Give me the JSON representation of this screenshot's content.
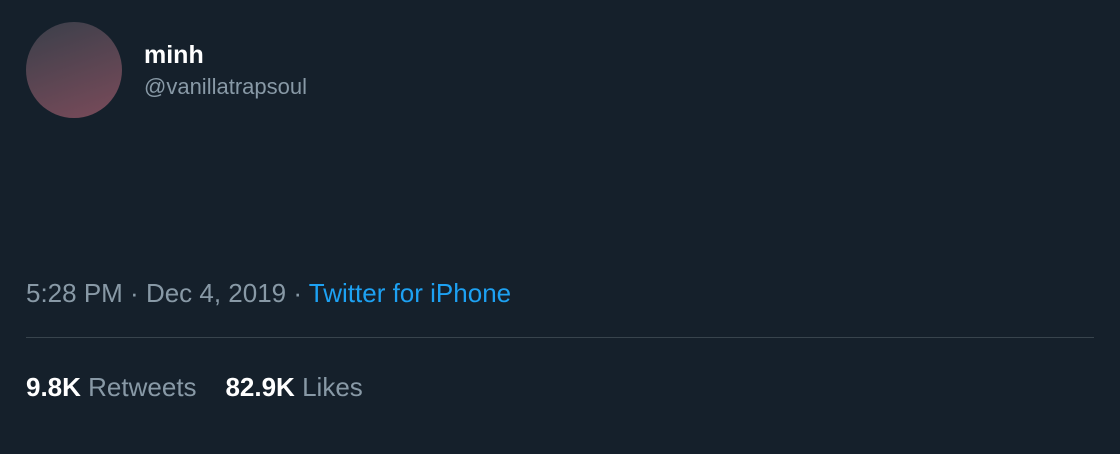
{
  "user": {
    "name": "minh",
    "handle": "@vanillatrapsoul"
  },
  "tweet": {
    "text": "",
    "time": "5:28 PM",
    "date": "Dec 4, 2019",
    "source": "Twitter for iPhone"
  },
  "stats": {
    "retweets": "9.8K",
    "retweets_label": "Retweets",
    "likes": "82.9K",
    "likes_label": "Likes"
  }
}
